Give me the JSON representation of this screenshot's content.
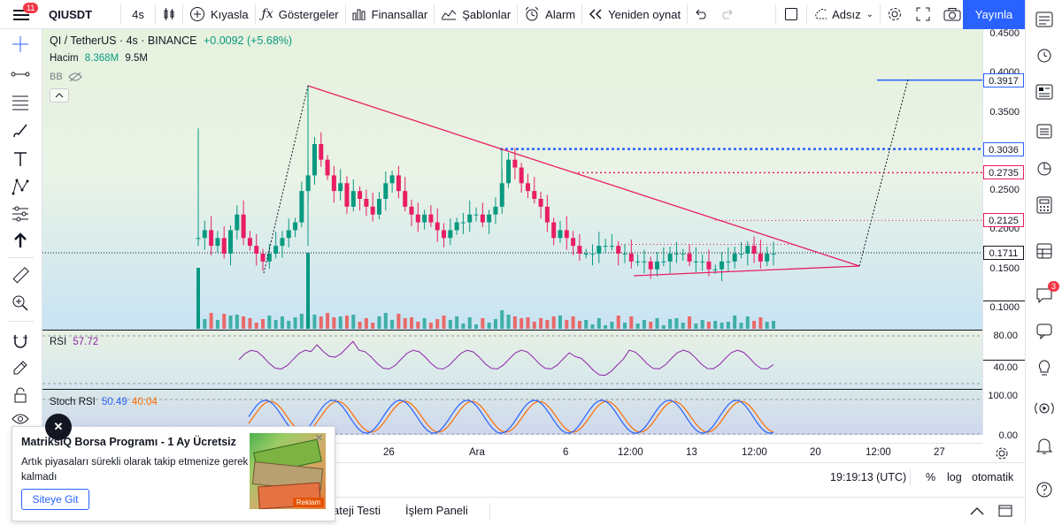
{
  "toolbar": {
    "badge": "11",
    "symbol": "QIUSDT",
    "interval": "4s",
    "compare": "Kıyasla",
    "indicators": "Göstergeler",
    "financials": "Finansallar",
    "templates": "Şablonlar",
    "alert": "Alarm",
    "replay": "Yeniden oynat",
    "layout_name": "Adsız",
    "publish": "Yayınla"
  },
  "legend": {
    "title": "QI / TetherUS · 4s · BINANCE",
    "change": "+0.0092 (+5.68%)",
    "volume_label": "Hacim",
    "volume_value1": "8.368M",
    "volume_value2": "9.5M",
    "bb_label": "BB"
  },
  "price_scale": {
    "ticks": [
      "0.4500",
      "0.4000",
      "0.3500",
      "0.3000",
      "0.2500",
      "0.2000",
      "0.1500",
      "0.1000"
    ],
    "labels": [
      {
        "value": "0.3917",
        "color": "#2962ff"
      },
      {
        "value": "0.3036",
        "color": "#2962ff"
      },
      {
        "value": "0.2735",
        "color": "#e91e63"
      },
      {
        "value": "0.2125",
        "color": "#e91e63"
      },
      {
        "value": "0.1711",
        "color": "#131722"
      }
    ]
  },
  "rsi": {
    "label": "RSI",
    "value": "57.72",
    "ticks": [
      "80.00",
      "40.00"
    ]
  },
  "stoch": {
    "label": "Stoch RSI",
    "k": "50.49",
    "d": "40.04",
    "ticks": [
      "100.00",
      "0.00"
    ]
  },
  "time_axis": [
    "26",
    "Ara",
    "6",
    "12:00",
    "13",
    "12:00",
    "20",
    "12:00",
    "27"
  ],
  "bottom": {
    "clock": "19:19:13 (UTC)",
    "percent": "%",
    "log": "log",
    "auto": "otomatik"
  },
  "tabs": [
    "ateji Testi",
    "İşlem Paneli"
  ],
  "popup": {
    "title": "MatriksIQ Borsa Programı - 1 Ay Ücretsiz",
    "body": "Artık piyasaları sürekli olarak takip etmenize gerek kalmadı",
    "button": "Siteye Git",
    "ad": "Reklam",
    "close": "✕"
  },
  "right_badge": "3",
  "chart_data": {
    "type": "line",
    "title": "QI / TetherUS · 4s · BINANCE",
    "ylim": [
      0.08,
      0.46
    ],
    "y_ticks": [
      0.45,
      0.4,
      0.35,
      0.3,
      0.25,
      0.2,
      0.15,
      0.1
    ],
    "last_price": 0.1711,
    "levels": [
      0.3917,
      0.3036,
      0.2735,
      0.2125,
      0.1711
    ],
    "series": [
      {
        "values": [
          0.19,
          0.2,
          0.18,
          0.19,
          0.17,
          0.2,
          0.22,
          0.19,
          0.18,
          0.17,
          0.16,
          0.17,
          0.18,
          0.19,
          0.2,
          0.21,
          0.25,
          0.27,
          0.31,
          0.29,
          0.27,
          0.25,
          0.26,
          0.23,
          0.25,
          0.24,
          0.23,
          0.22,
          0.24,
          0.26,
          0.27,
          0.25,
          0.23,
          0.22,
          0.21,
          0.22,
          0.21,
          0.2,
          0.19,
          0.2,
          0.21,
          0.21,
          0.22,
          0.22,
          0.21,
          0.22,
          0.23,
          0.26,
          0.29,
          0.28,
          0.26,
          0.25,
          0.24,
          0.23,
          0.21,
          0.19,
          0.2,
          0.19,
          0.18,
          0.17,
          0.17,
          0.17,
          0.18,
          0.18,
          0.18,
          0.17,
          0.17,
          0.16,
          0.16,
          0.16,
          0.15,
          0.16,
          0.16,
          0.17,
          0.17,
          0.17,
          0.16,
          0.16,
          0.16,
          0.15,
          0.15,
          0.16,
          0.16,
          0.17,
          0.17,
          0.18,
          0.17,
          0.16,
          0.17,
          0.17
        ]
      }
    ]
  }
}
